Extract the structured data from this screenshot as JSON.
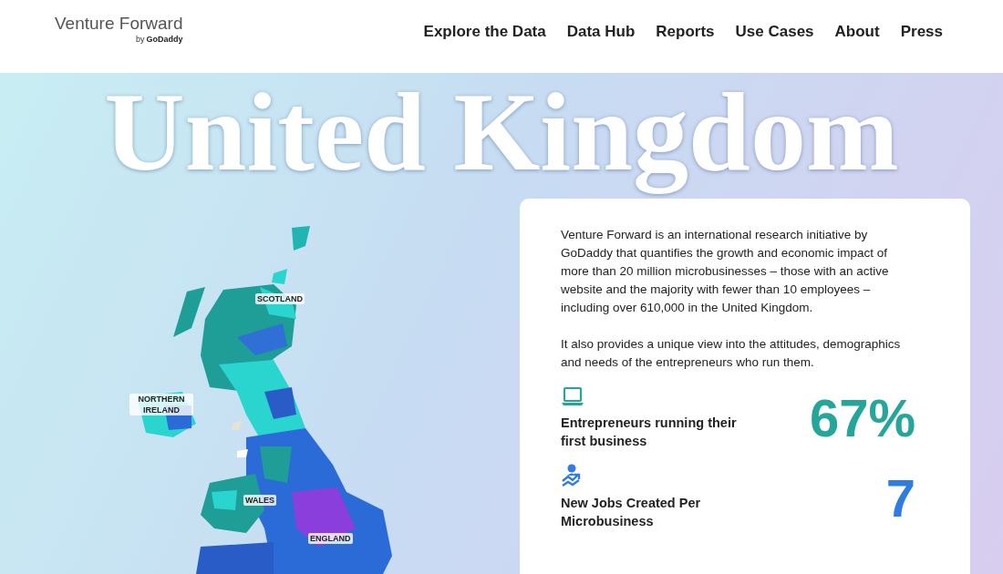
{
  "logo": {
    "name": "Venture Forward",
    "byline": "by",
    "brand": "GoDaddy"
  },
  "nav": [
    {
      "label": "Explore the Data"
    },
    {
      "label": "Data Hub"
    },
    {
      "label": "Reports"
    },
    {
      "label": "Use Cases"
    },
    {
      "label": "About"
    },
    {
      "label": "Press"
    }
  ],
  "hero": {
    "title": "United Kingdom"
  },
  "map": {
    "labels": [
      {
        "text": "SCOTLAND"
      },
      {
        "text": "NORTHERN IRELAND"
      },
      {
        "text": "WALES"
      },
      {
        "text": "ENGLAND"
      }
    ]
  },
  "card": {
    "paragraphs": [
      "Venture Forward is an international research initiative by GoDaddy that quantifies the growth and economic impact of more than 20 million microbusinesses – those with an active website and the majority with fewer than 10 employees – including over 610,000 in the United Kingdom.",
      "It also provides a unique view into the attitudes, demographics and needs of the entrepreneurs who run them."
    ],
    "stats": [
      {
        "kind": "laptop",
        "label": "Entrepreneurs running their first business",
        "value": "67%",
        "color": "#26a69a"
      },
      {
        "kind": "growth",
        "label": "New Jobs Created Per Microbusiness",
        "value": "7",
        "color": "#2f7de1"
      }
    ]
  }
}
